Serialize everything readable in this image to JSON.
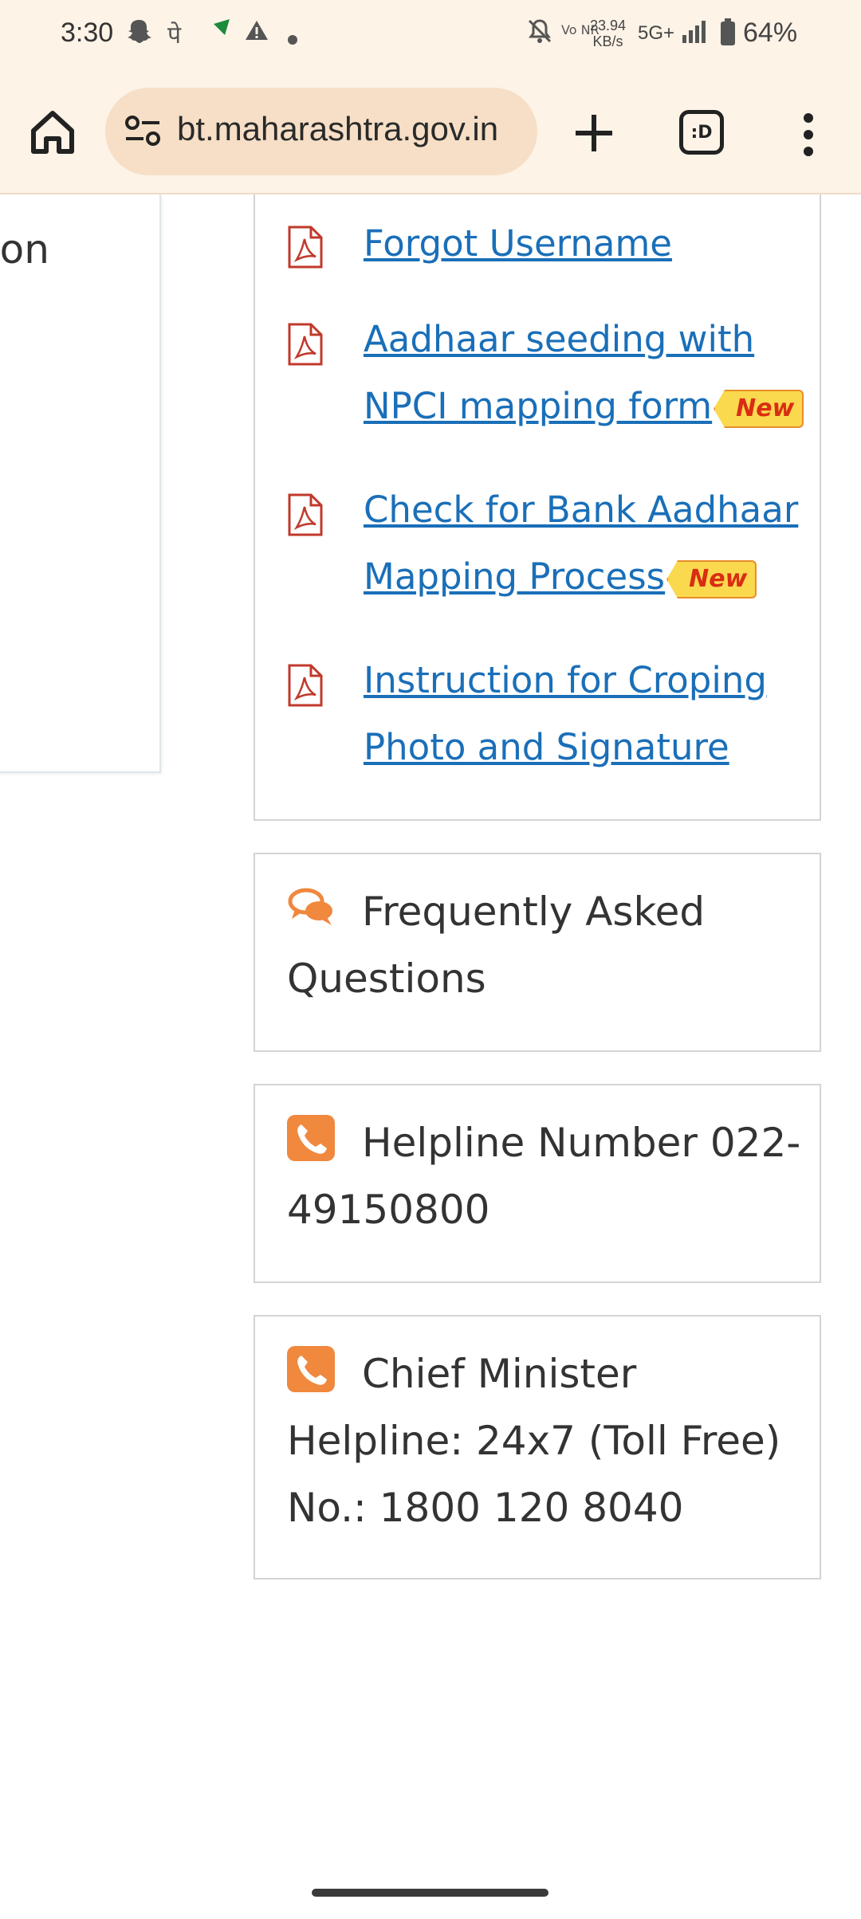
{
  "status_bar": {
    "time": "3:30",
    "hindi_glyph": "पे",
    "data_speed_value": "23.94",
    "data_speed_unit": "KB/s",
    "volte": "Vo NR",
    "network": "5G+",
    "battery": "64%",
    "notification_icons": [
      "snapchat-icon",
      "flag-icon",
      "warning-icon",
      "dot-icon"
    ]
  },
  "browser": {
    "url": "bt.maharashtra.gov.in",
    "tab_count_label": ":D"
  },
  "left_panel": {
    "clipped_text": "ton"
  },
  "links": [
    {
      "label": "Forgot Username",
      "underlined": false,
      "badge": ""
    },
    {
      "label": "Aadhaar seeding with NPCI mapping form",
      "underlined": true,
      "badge": "New"
    },
    {
      "label": "Check for Bank Aadhaar Mapping Process",
      "underlined": false,
      "badge": "New"
    },
    {
      "label": "Instruction for Croping Photo and Signature",
      "underlined": false,
      "badge": ""
    }
  ],
  "faq": {
    "label": "Frequently Asked Questions"
  },
  "helpline": {
    "label": "Helpline Number 022-49150800"
  },
  "cm_helpline": {
    "label": "Chief Minister Helpline: 24x7 (Toll Free) No.: 1800 120 8040"
  },
  "colors": {
    "link": "#1a6fb8",
    "accent_orange": "#f0883e",
    "pdf_red": "#c0392b",
    "toolbar_bg": "#fdf3e7",
    "urlbar_bg": "#f6dfc6"
  }
}
